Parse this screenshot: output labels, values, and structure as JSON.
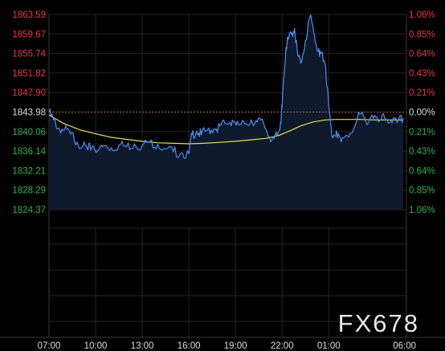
{
  "watermark": "FX678",
  "colors": {
    "background": "#000000",
    "grid": "#262626",
    "border": "#3a3a3a",
    "price_line": "#4d8ff5",
    "price_fill": "#0e1a2c",
    "ma_line": "#e8e04a",
    "reference_line": "#e0604a",
    "up_label": "#e8354a",
    "down_label": "#2ab84a",
    "neutral_label": "#dddddd",
    "time_label": "#dddddd",
    "watermark": "#e6e6e6"
  },
  "chart_data": {
    "type": "line",
    "title": "",
    "xlabel": "",
    "ylabel": "",
    "reference_price": 1843.98,
    "ylim": [
      1824.37,
      1863.59
    ],
    "grid": true,
    "left_axis_labels": [
      {
        "text": "1863.59",
        "value": 1863.59,
        "tone": "up"
      },
      {
        "text": "1859.67",
        "value": 1859.67,
        "tone": "up"
      },
      {
        "text": "1855.74",
        "value": 1855.74,
        "tone": "up"
      },
      {
        "text": "1851.82",
        "value": 1851.82,
        "tone": "up"
      },
      {
        "text": "1847.90",
        "value": 1847.9,
        "tone": "up"
      },
      {
        "text": "1843.98",
        "value": 1843.98,
        "tone": "neutral"
      },
      {
        "text": "1840.06",
        "value": 1840.06,
        "tone": "down"
      },
      {
        "text": "1836.14",
        "value": 1836.14,
        "tone": "down"
      },
      {
        "text": "1832.21",
        "value": 1832.21,
        "tone": "down"
      },
      {
        "text": "1828.29",
        "value": 1828.29,
        "tone": "down"
      },
      {
        "text": "1824.37",
        "value": 1824.37,
        "tone": "down"
      }
    ],
    "right_axis_labels": [
      {
        "text": "1.06%",
        "value": 1863.59,
        "tone": "up"
      },
      {
        "text": "0.85%",
        "value": 1859.67,
        "tone": "up"
      },
      {
        "text": "0.64%",
        "value": 1855.74,
        "tone": "up"
      },
      {
        "text": "0.43%",
        "value": 1851.82,
        "tone": "up"
      },
      {
        "text": "0.21%",
        "value": 1847.9,
        "tone": "up"
      },
      {
        "text": "0.00%",
        "value": 1843.98,
        "tone": "neutral"
      },
      {
        "text": "0.21%",
        "value": 1840.06,
        "tone": "down"
      },
      {
        "text": "0.43%",
        "value": 1836.14,
        "tone": "down"
      },
      {
        "text": "0.64%",
        "value": 1832.21,
        "tone": "down"
      },
      {
        "text": "0.85%",
        "value": 1828.29,
        "tone": "down"
      },
      {
        "text": "1.06%",
        "value": 1824.37,
        "tone": "down"
      }
    ],
    "x_ticks": [
      {
        "label": "07:00",
        "hour": 7
      },
      {
        "label": "10:00",
        "hour": 10
      },
      {
        "label": "13:00",
        "hour": 13
      },
      {
        "label": "16:00",
        "hour": 16
      },
      {
        "label": "19:00",
        "hour": 19
      },
      {
        "label": "22:00",
        "hour": 22
      },
      {
        "label": "01:00",
        "hour": 25
      },
      {
        "label": "06:00",
        "hour": 30
      }
    ],
    "xlim_hours": [
      7,
      30
    ],
    "series": [
      {
        "key": "price",
        "x": [
          7.0,
          7.3,
          7.6,
          8.0,
          8.4,
          8.8,
          9.2,
          9.5,
          9.8,
          10.2,
          10.6,
          11.0,
          11.5,
          12.0,
          12.5,
          13.0,
          13.5,
          14.0,
          14.5,
          15.0,
          15.5,
          16.0,
          16.2,
          16.5,
          16.8,
          17.2,
          17.6,
          18.0,
          18.4,
          18.8,
          19.2,
          19.6,
          20.0,
          20.4,
          20.8,
          21.2,
          21.5,
          21.7,
          21.9,
          22.0,
          22.1,
          22.25,
          22.4,
          22.6,
          22.8,
          23.0,
          23.2,
          23.5,
          23.8,
          24.0,
          24.2,
          24.4,
          24.6,
          24.8,
          25.0,
          25.2,
          25.5,
          25.8,
          26.2,
          26.6,
          27.0,
          27.4,
          27.8,
          28.2,
          28.6,
          29.0,
          29.4,
          29.8
        ],
        "values": [
          1843.9,
          1842.4,
          1840.8,
          1840.4,
          1839.6,
          1838.0,
          1837.4,
          1836.4,
          1837.2,
          1836.4,
          1837.2,
          1836.8,
          1837.4,
          1837.0,
          1837.6,
          1837.3,
          1838.0,
          1837.5,
          1836.6,
          1836.0,
          1835.8,
          1835.6,
          1839.4,
          1840.2,
          1839.4,
          1840.4,
          1840.6,
          1841.2,
          1841.6,
          1842.4,
          1841.4,
          1841.6,
          1842.4,
          1842.0,
          1841.8,
          1839.0,
          1838.6,
          1839.4,
          1842.0,
          1845.0,
          1851.0,
          1857.0,
          1858.6,
          1859.6,
          1860.8,
          1855.4,
          1853.8,
          1858.4,
          1863.2,
          1860.8,
          1857.6,
          1855.2,
          1855.8,
          1853.2,
          1845.0,
          1839.2,
          1840.2,
          1838.0,
          1839.2,
          1840.6,
          1843.6,
          1842.0,
          1843.4,
          1842.0,
          1842.8,
          1842.2,
          1841.8,
          1842.8
        ]
      },
      {
        "key": "moving_average",
        "x": [
          7.0,
          8.0,
          9.0,
          10.0,
          11.0,
          12.0,
          13.0,
          14.0,
          15.0,
          16.0,
          17.0,
          18.0,
          19.0,
          20.0,
          21.0,
          21.8,
          22.5,
          23.2,
          24.0,
          24.8,
          25.5,
          26.2,
          27.0,
          28.0,
          29.0,
          29.8
        ],
        "values": [
          1843.4,
          1841.6,
          1840.4,
          1839.6,
          1838.9,
          1838.5,
          1838.1,
          1837.8,
          1837.7,
          1837.6,
          1837.7,
          1837.9,
          1838.1,
          1838.4,
          1838.7,
          1839.3,
          1840.2,
          1841.2,
          1842.0,
          1842.4,
          1842.5,
          1842.5,
          1842.5,
          1842.4,
          1842.4,
          1842.4
        ]
      }
    ]
  }
}
